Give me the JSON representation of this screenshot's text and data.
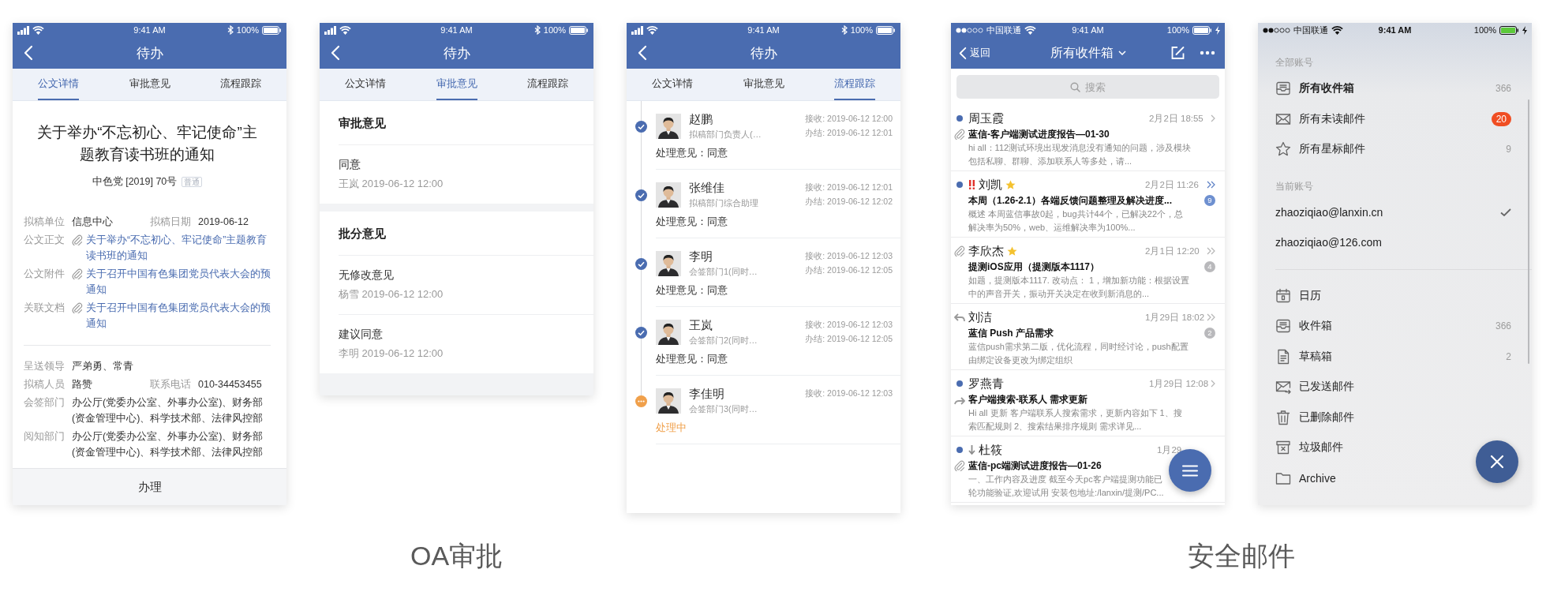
{
  "groups": [
    {
      "label": "OA审批",
      "screens": [
        {
          "kind": "oa_detail",
          "status_bar": {
            "time": "9:41 AM",
            "battery": "100%"
          },
          "nav": {
            "title": "待办"
          },
          "tabs": [
            {
              "label": "公文详情",
              "selected": true
            },
            {
              "label": "审批意见",
              "selected": false
            },
            {
              "label": "流程跟踪",
              "selected": false
            }
          ],
          "document": {
            "title": "关于举办“不忘初心、牢记使命”主题教育读书班的通知",
            "number": "中色党 [2019] 70号",
            "grade": "普通",
            "sections": [
              [
                {
                  "kind": "pair",
                  "items": [
                    {
                      "label": "拟稿单位",
                      "value": "信息中心"
                    },
                    {
                      "label": "拟稿日期",
                      "value": "2019-06-12"
                    }
                  ]
                },
                {
                  "kind": "link",
                  "label": "公文正文",
                  "value": "关于举办“不忘初心、牢记使命”主题教育读书班的通知"
                },
                {
                  "kind": "link",
                  "label": "公文附件",
                  "value": "关于召开中国有色集团党员代表大会的预通知"
                },
                {
                  "kind": "link",
                  "label": "关联文档",
                  "value": "关于召开中国有色集团党员代表大会的预通知"
                }
              ],
              [
                {
                  "kind": "text",
                  "label": "呈送领导",
                  "value": "严弟勇、常青"
                },
                {
                  "kind": "pair",
                  "items": [
                    {
                      "label": "拟稿人员",
                      "value": "路赞"
                    },
                    {
                      "label": "联系电话",
                      "value": "010-34453455"
                    }
                  ]
                },
                {
                  "kind": "text",
                  "label": "会签部门",
                  "value": "办公厅(党委办公室、外事办公室)、财务部(资金管理中心)、科学技术部、法律风控部"
                },
                {
                  "kind": "text",
                  "label": "阅知部门",
                  "value": "办公厅(党委办公室、外事办公室)、财务部(资金管理中心)、科学技术部、法律风控部"
                }
              ]
            ]
          },
          "action": "办理"
        },
        {
          "kind": "oa_opinions",
          "status_bar": {
            "time": "9:41 AM",
            "battery": "100%"
          },
          "nav": {
            "title": "待办"
          },
          "tabs": [
            {
              "label": "公文详情",
              "selected": false
            },
            {
              "label": "审批意见",
              "selected": true
            },
            {
              "label": "流程跟踪",
              "selected": false
            }
          ],
          "opinions": [
            {
              "title": "审批意见",
              "entries": [
                {
                  "text": "同意",
                  "meta": "王岚 2019-06-12 12:00"
                }
              ]
            },
            {
              "title": "批分意见",
              "entries": [
                {
                  "text": "无修改意见",
                  "meta": "杨雪 2019-06-12 12:00"
                },
                {
                  "text": "建议同意",
                  "meta": "李明 2019-06-12 12:00"
                }
              ]
            }
          ]
        },
        {
          "kind": "oa_flow",
          "status_bar": {
            "time": "9:41 AM",
            "battery": "100%"
          },
          "nav": {
            "title": "待办"
          },
          "tabs": [
            {
              "label": "公文详情",
              "selected": false
            },
            {
              "label": "审批意见",
              "selected": false
            },
            {
              "label": "流程跟踪",
              "selected": true
            }
          ],
          "steps": [
            {
              "name": "赵鹏",
              "role": "拟稿部门负责人(…",
              "received": "接收: 2019-06-12 12:00",
              "finished": "办结: 2019-06-12 12:01",
              "opinion": "处理意见：同意",
              "done": true
            },
            {
              "name": "张维佳",
              "role": "拟稿部门综合助理",
              "received": "接收: 2019-06-12 12:01",
              "finished": "办结: 2019-06-12 12:02",
              "opinion": "处理意见：同意",
              "done": true
            },
            {
              "name": "李明",
              "role": "会签部门1(同时…",
              "received": "接收: 2019-06-12 12:03",
              "finished": "办结: 2019-06-12 12:05",
              "opinion": "处理意见：同意",
              "done": true
            },
            {
              "name": "王岚",
              "role": "会签部门2(同时…",
              "received": "接收: 2019-06-12 12:03",
              "finished": "办结: 2019-06-12 12:05",
              "opinion": "处理意见：同意",
              "done": true
            },
            {
              "name": "李佳明",
              "role": "会签部门3(同时…",
              "received": "接收: 2019-06-12 12:03",
              "opinion": "处理中",
              "done": false
            }
          ]
        }
      ]
    },
    {
      "label": "安全邮件",
      "screens": [
        {
          "kind": "mail_list",
          "status_bar": {
            "carrier": "中国联通",
            "time": "9:41 AM",
            "battery": "100%"
          },
          "nav": {
            "back": "返回",
            "title": "所有收件箱"
          },
          "search": {
            "placeholder": "搜索"
          },
          "mails": [
            {
              "sender": "周玉霞",
              "unread": true,
              "attachment": true,
              "replied": false,
              "forwarded": false,
              "urgent": false,
              "low_priority": false,
              "starred": false,
              "time": "2月2日 18:55",
              "thread": false,
              "subject": "蓝信-客户端测试进度报告—01-30",
              "preview": [
                "hi all：112测试环境出现发消息没有通知的问题，涉及模块",
                "包括私聊、群聊、添加联系人等多处，请..."
              ]
            },
            {
              "sender": "刘凯",
              "unread": true,
              "attachment": false,
              "replied": false,
              "forwarded": false,
              "urgent": true,
              "low_priority": false,
              "starred": true,
              "time": "2月2日 11:26",
              "thread": true,
              "thread_unread": true,
              "count": "9",
              "subject": "本周（1.26-2.1）各端反馈问题整理及解决进度...",
              "preview": [
                "概述 本周蓝信事故0起，bug共计44个，已解决22个，总",
                "解决率为50%，web、运维解决率为100%..."
              ]
            },
            {
              "sender": "李欣杰",
              "unread": false,
              "attachment": true,
              "replied": false,
              "forwarded": false,
              "urgent": false,
              "low_priority": false,
              "starred": true,
              "time": "2月1日 12:20",
              "thread": true,
              "thread_unread": false,
              "count": "4",
              "subject": "提测iOS应用（提测版本1117）",
              "preview": [
                "如题，提测版本1117. 改动点： 1，增加新功能：根据设置",
                "中的声音开关，振动开关决定在收到新消息的..."
              ]
            },
            {
              "sender": "刘洁",
              "unread": false,
              "attachment": false,
              "replied": true,
              "forwarded": false,
              "urgent": false,
              "low_priority": false,
              "starred": false,
              "time": "1月29日 18:02",
              "thread": true,
              "thread_unread": false,
              "count": "2",
              "subject": "蓝信 Push 产品需求",
              "preview": [
                "蓝信push需求第二版，优化流程，同时经讨论，push配置",
                "由绑定设备更改为绑定组织"
              ]
            },
            {
              "sender": "罗燕青",
              "unread": true,
              "attachment": false,
              "replied": false,
              "forwarded": true,
              "urgent": false,
              "low_priority": false,
              "starred": false,
              "time": "1月29日 12:08",
              "thread": false,
              "subject": "客户端搜索-联系人 需求更新",
              "preview": [
                "Hi  all 更新 客户端联系人搜索需求，更新内容如下 1、搜",
                "索匹配规则 2、搜索结果排序规则  需求详见..."
              ]
            },
            {
              "sender": "杜筱",
              "unread": true,
              "attachment": true,
              "replied": false,
              "forwarded": false,
              "urgent": false,
              "low_priority": true,
              "starred": false,
              "time": "1月29",
              "subject": "蓝信-pc端测试进度报告—01-26",
              "preview": [
                "一、工作内容及进度 截至今天pc客户端提测功能已",
                "轮功能验证,欢迎试用 安装包地址:/lanxin/提测/PC..."
              ]
            }
          ]
        },
        {
          "kind": "mail_menu",
          "status_bar": {
            "carrier": "中国联通",
            "time": "9:41 AM",
            "battery": "100%"
          },
          "all_accounts": {
            "title": "全部账号",
            "items": [
              {
                "kind": "inbox",
                "label": "所有收件箱",
                "count": "366",
                "alert": false,
                "selected": true
              },
              {
                "kind": "unread",
                "label": "所有未读邮件",
                "count": "20",
                "alert": true,
                "selected": false
              },
              {
                "kind": "starred",
                "label": "所有星标邮件",
                "count": "9",
                "alert": false,
                "selected": false
              }
            ]
          },
          "current_account": {
            "title": "当前账号",
            "accounts": [
              {
                "address": "zhaoziqiao@lanxin.cn",
                "selected": true
              },
              {
                "address": "zhaoziqiao@126.com",
                "selected": false
              }
            ]
          },
          "folders": [
            {
              "kind": "calendar",
              "label": "日历"
            },
            {
              "kind": "inbox",
              "label": "收件箱",
              "count": "366"
            },
            {
              "kind": "draft",
              "label": "草稿箱",
              "count": "2"
            },
            {
              "kind": "sent",
              "label": "已发送邮件"
            },
            {
              "kind": "trash",
              "label": "已删除邮件"
            },
            {
              "kind": "junk",
              "label": "垃圾邮件"
            },
            {
              "kind": "folder",
              "label": "Archive"
            }
          ]
        }
      ]
    }
  ]
}
